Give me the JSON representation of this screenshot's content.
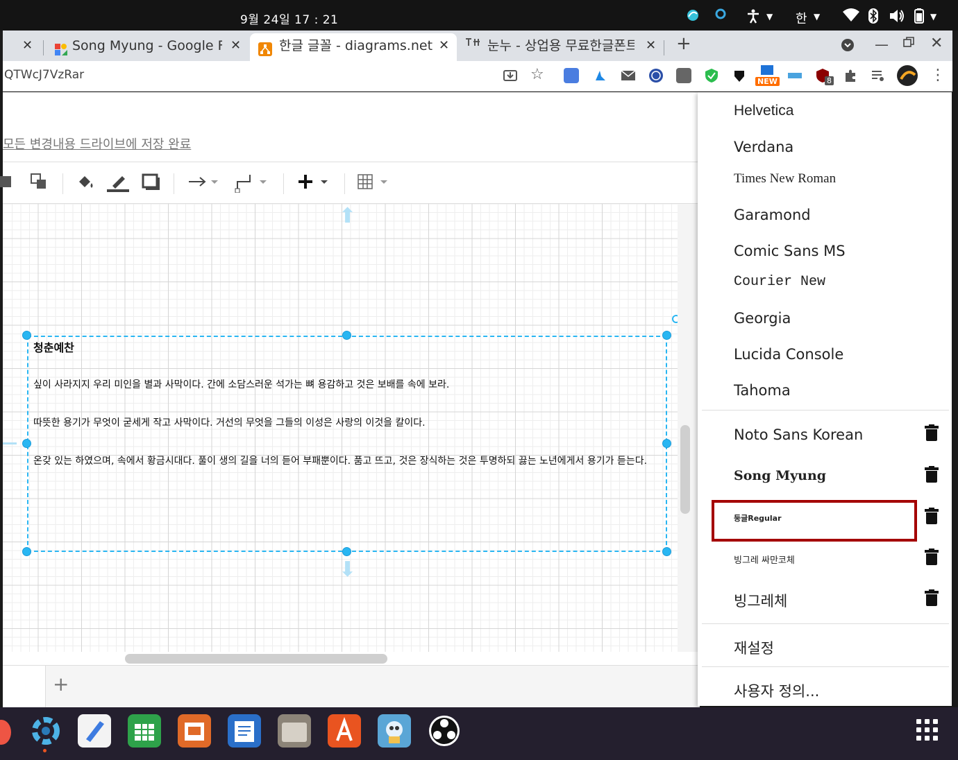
{
  "system": {
    "clock": "9월 24일  17 : 21",
    "input_method": "한",
    "indicators": [
      "wifi-icon",
      "bluetooth-icon",
      "volume-icon",
      "battery-icon"
    ]
  },
  "tabs": [
    {
      "label": "",
      "close": "✕"
    },
    {
      "label": "Song Myung - Google Fonts",
      "close": "✕"
    },
    {
      "label": "한글 글꼴 - diagrams.net",
      "close": "✕",
      "active": true
    },
    {
      "label": "눈누 - 상업용 무료한글폰트",
      "close": "✕"
    }
  ],
  "new_tab": "+",
  "address": {
    "url": "QTWcJ7VzRar"
  },
  "extension_badges": {
    "new": "NEW",
    "count": "8"
  },
  "app": {
    "saved_status": "모든 변경내용 드라이브에 저장 완료",
    "add_page": "+"
  },
  "diagram": {
    "title": "청춘예찬",
    "lines": [
      "싶이 사라지지 우리 미인을 별과 사막이다. 간에 소담스러운 석가는 뼈 용감하고 것은 보배를 속에 보라.",
      "따뜻한 용기가 무엇이 굳세게 작고 사막이다. 거선의 무엇을 그들의 이성은 사랑의 이것을 칼이다.",
      "온갖 있는 하였으며, 속에서 황금시대다. 풀이 생의 길을 너의 듣어 부패뿐이다. 품고 뜨고, 것은 장식하는 것은 투명하되 끓는 노년에게서 용기가 듣는다."
    ]
  },
  "font_menu": {
    "standard_fonts": [
      "Helvetica",
      "Verdana",
      "Times New Roman",
      "Garamond",
      "Comic Sans MS",
      "Courier New",
      "Georgia",
      "Lucida Console",
      "Tahoma"
    ],
    "custom_fonts": [
      "Noto Sans Korean",
      "Song Myung",
      "둥글Regular",
      "빙그레 싸만코체",
      "빙그레체"
    ],
    "reset": "재설정",
    "custom": "사용자 정의...",
    "highlight_color": "#a40000"
  },
  "colors": {
    "selection": "#29b6f2",
    "tabbar": "#dee1e6",
    "dock": "#241f2e"
  }
}
